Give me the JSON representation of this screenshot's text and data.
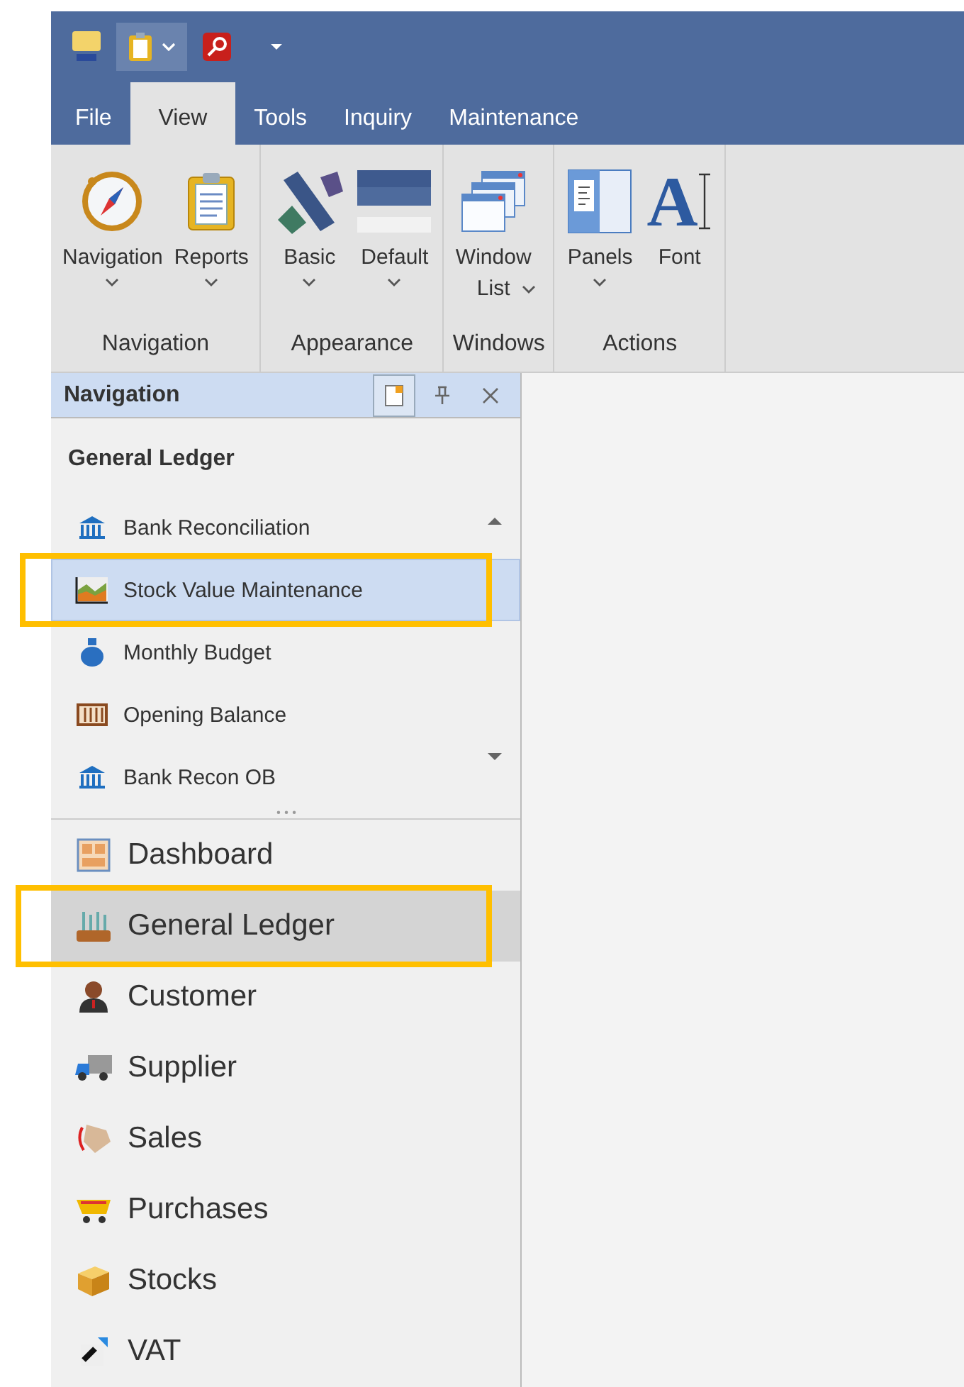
{
  "tabs": [
    {
      "label": "File",
      "selected": false
    },
    {
      "label": "View",
      "selected": true
    },
    {
      "label": "Tools",
      "selected": false
    },
    {
      "label": "Inquiry",
      "selected": false
    },
    {
      "label": "Maintenance",
      "selected": false
    }
  ],
  "ribbon_groups": [
    {
      "label": "Navigation",
      "buttons": [
        {
          "label_lines": [
            "Navigation"
          ],
          "dropdown": true
        },
        {
          "label_lines": [
            "Reports"
          ],
          "dropdown": true
        }
      ]
    },
    {
      "label": "Appearance",
      "buttons": [
        {
          "label_lines": [
            "Basic"
          ],
          "dropdown": true
        },
        {
          "label_lines": [
            "Default"
          ],
          "dropdown": true
        }
      ]
    },
    {
      "label": "Windows",
      "buttons": [
        {
          "label_lines": [
            "Window",
            "List"
          ],
          "dropdown": true
        }
      ]
    },
    {
      "label": "Actions",
      "buttons": [
        {
          "label_lines": [
            "Panels"
          ],
          "dropdown": true
        },
        {
          "label_lines": [
            "Font"
          ],
          "dropdown": false,
          "glyph": "A"
        }
      ]
    }
  ],
  "panel": {
    "title": "Navigation",
    "group_title": "General Ledger",
    "items": [
      {
        "label": "Bank Reconciliation",
        "selected": false,
        "highlighted": false
      },
      {
        "label": "Stock Value Maintenance",
        "selected": true,
        "highlighted": true
      },
      {
        "label": "Monthly Budget",
        "selected": false,
        "highlighted": false
      },
      {
        "label": "Opening Balance",
        "selected": false,
        "highlighted": false
      },
      {
        "label": "Bank Recon OB",
        "selected": false,
        "highlighted": false
      }
    ],
    "categories": [
      {
        "label": "Dashboard",
        "selected": false,
        "highlighted": false
      },
      {
        "label": "General Ledger",
        "selected": true,
        "highlighted": true
      },
      {
        "label": "Customer",
        "selected": false,
        "highlighted": false
      },
      {
        "label": "Supplier",
        "selected": false,
        "highlighted": false
      },
      {
        "label": "Sales",
        "selected": false,
        "highlighted": false
      },
      {
        "label": "Purchases",
        "selected": false,
        "highlighted": false
      },
      {
        "label": "Stocks",
        "selected": false,
        "highlighted": false
      },
      {
        "label": "VAT",
        "selected": false,
        "highlighted": false
      }
    ]
  }
}
